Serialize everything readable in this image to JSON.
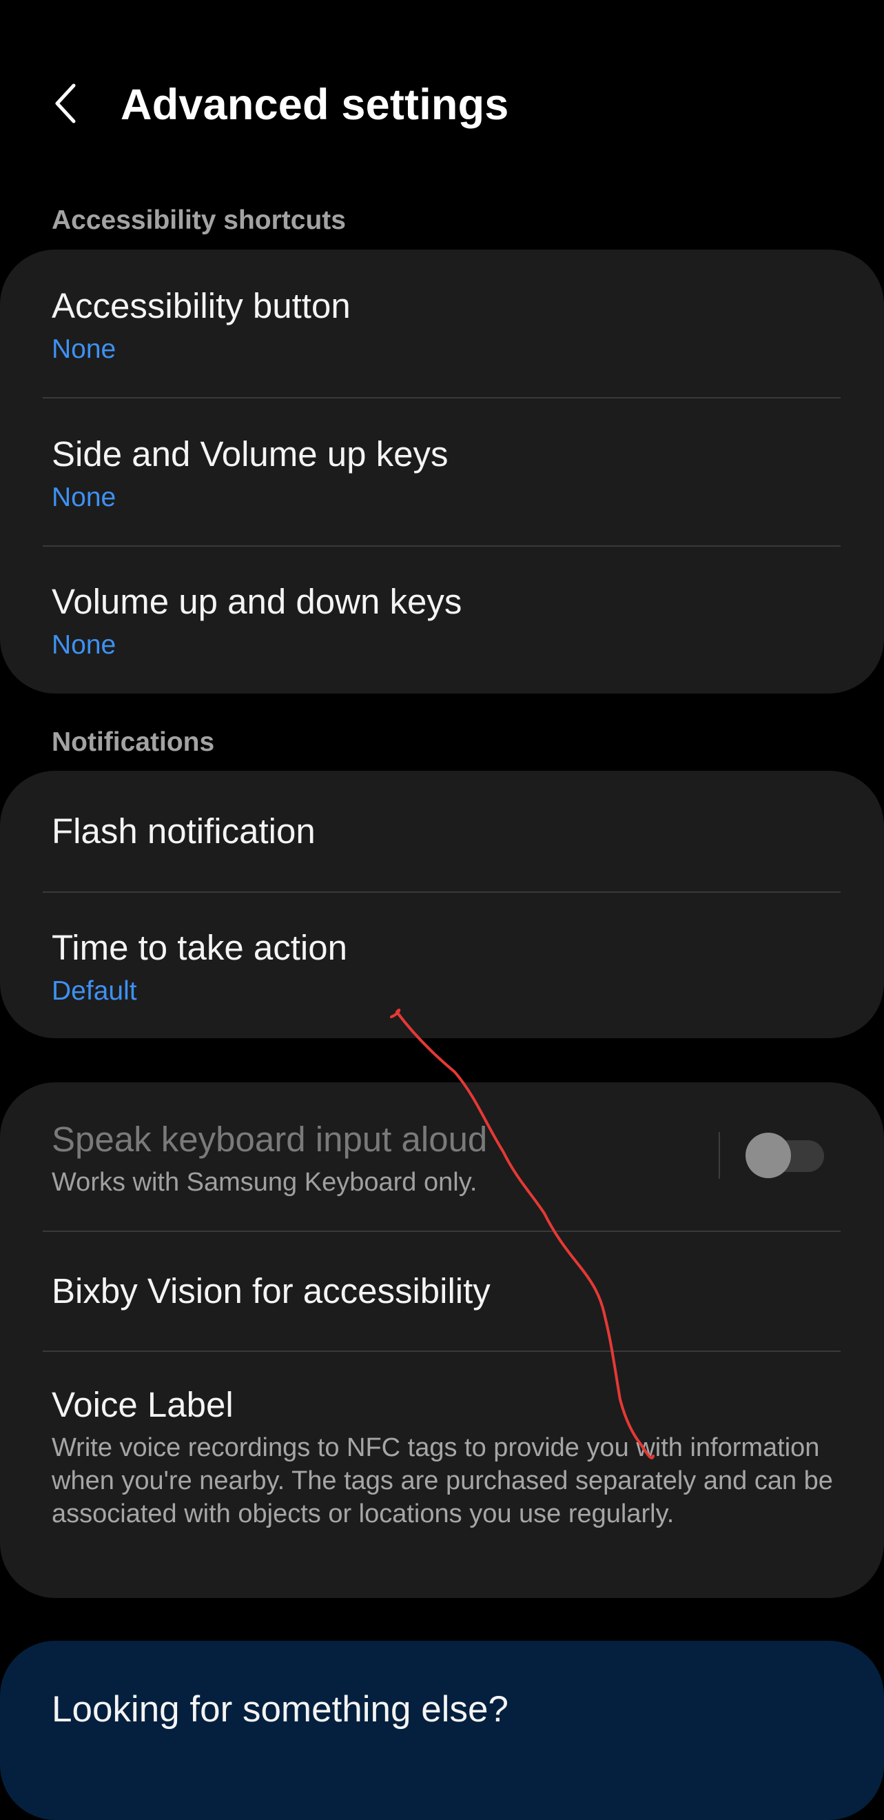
{
  "header": {
    "title": "Advanced settings",
    "back_icon": "chevron-left-icon"
  },
  "sections": {
    "accessibility_shortcuts": {
      "label": "Accessibility shortcuts",
      "items": [
        {
          "title": "Accessibility button",
          "value": "None"
        },
        {
          "title": "Side and Volume up keys",
          "value": "None"
        },
        {
          "title": "Volume up and down keys",
          "value": "None"
        }
      ]
    },
    "notifications": {
      "label": "Notifications",
      "items": [
        {
          "title": "Flash notification"
        },
        {
          "title": "Time to take action",
          "value": "Default"
        }
      ]
    },
    "other": {
      "items": [
        {
          "title": "Speak keyboard input aloud",
          "description": "Works with Samsung Keyboard only.",
          "toggle": "off",
          "enabled": false
        },
        {
          "title": "Bixby Vision for accessibility"
        },
        {
          "title": "Voice Label",
          "description": "Write voice recordings to NFC tags to provide you with information when you're nearby. The tags are purchased separately and can be associated with objects or locations you use regularly."
        }
      ]
    }
  },
  "footer": {
    "title": "Looking for something else?"
  },
  "colors": {
    "background": "#000000",
    "card": "#1c1c1c",
    "accent_value": "#3e91f2",
    "footer_card": "#04203e",
    "annotation_stroke": "#e53935"
  }
}
